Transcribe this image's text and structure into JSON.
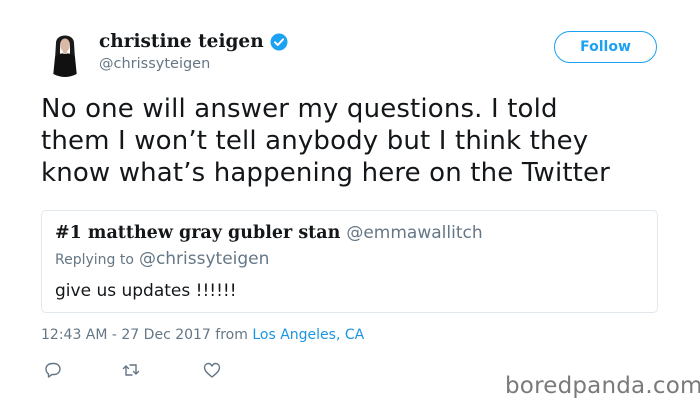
{
  "tweet": {
    "author": {
      "display_name": "christine teigen",
      "handle": "@chrissyteigen",
      "verified": true,
      "avatar_icon": "avatar-photo"
    },
    "follow_label": "Follow",
    "text_lines": [
      "No one will answer my questions. I told",
      "them I won’t tell anybody but I think they",
      "know what’s happening here on the Twitter"
    ],
    "quoted_tweet": {
      "display_name": "#1 matthew gray gubler stan",
      "handle": "@emmawallitch",
      "replying_label": "Replying to",
      "replying_handle": "@chrissyteigen",
      "text": "give us updates !!!!!!"
    },
    "timestamp": "12:43 AM - 27 Dec 2017",
    "from_label": "from",
    "location": "Los Angeles, CA",
    "actions": [
      "reply-icon",
      "retweet-icon",
      "like-icon"
    ]
  },
  "watermark": "boredpanda.com",
  "colors": {
    "accent": "#1da1f2",
    "link": "#1b95e0",
    "secondary_text": "#657786",
    "primary_text": "#14171a",
    "border": "#e1e8ed"
  }
}
